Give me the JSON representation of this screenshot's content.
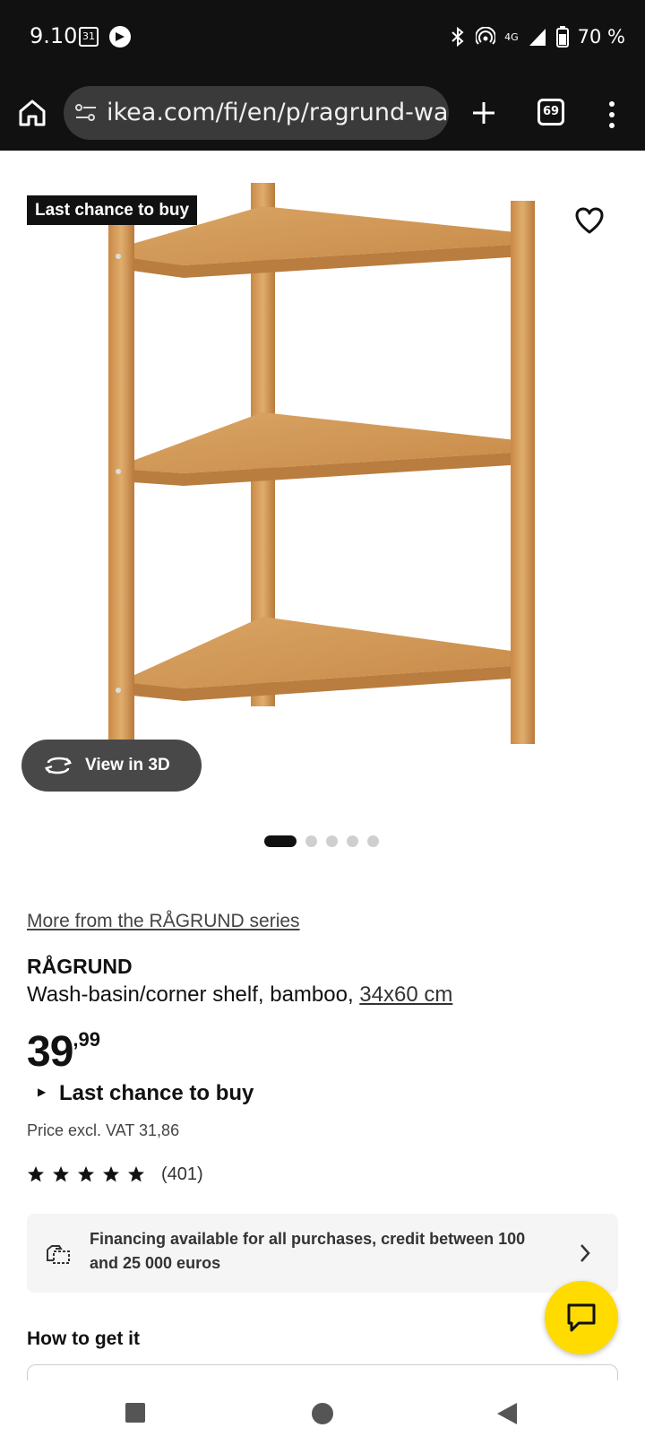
{
  "status_bar": {
    "time": "9.10",
    "calendar_day": "31",
    "network": "4G",
    "battery": "70 %"
  },
  "browser": {
    "url": "ikea.com/fi/en/p/ragrund-wash",
    "tab_count": "69"
  },
  "product_image": {
    "badge": "Last chance to buy",
    "view_3d_label": "View in 3D",
    "image_count": 5,
    "active_index": 0
  },
  "product": {
    "series_link": "More from the RÅGRUND series",
    "name": "RÅGRUND",
    "description": "Wash-basin/corner shelf, bamboo, ",
    "size": "34x60 cm",
    "price_int": "39",
    "price_dec": ",99",
    "availability": "Last chance to buy",
    "vat_text": "Price excl. VAT 31,86",
    "rating_stars": 5,
    "review_count": "(401)"
  },
  "financing": {
    "text": "Financing available for all purchases, credit between 100 and 25 000 euros"
  },
  "delivery": {
    "heading": "How to get it"
  },
  "colors": {
    "chat_button": "#ffdb00",
    "dark_bar": "#111111",
    "bamboo": "#d9a25e"
  }
}
